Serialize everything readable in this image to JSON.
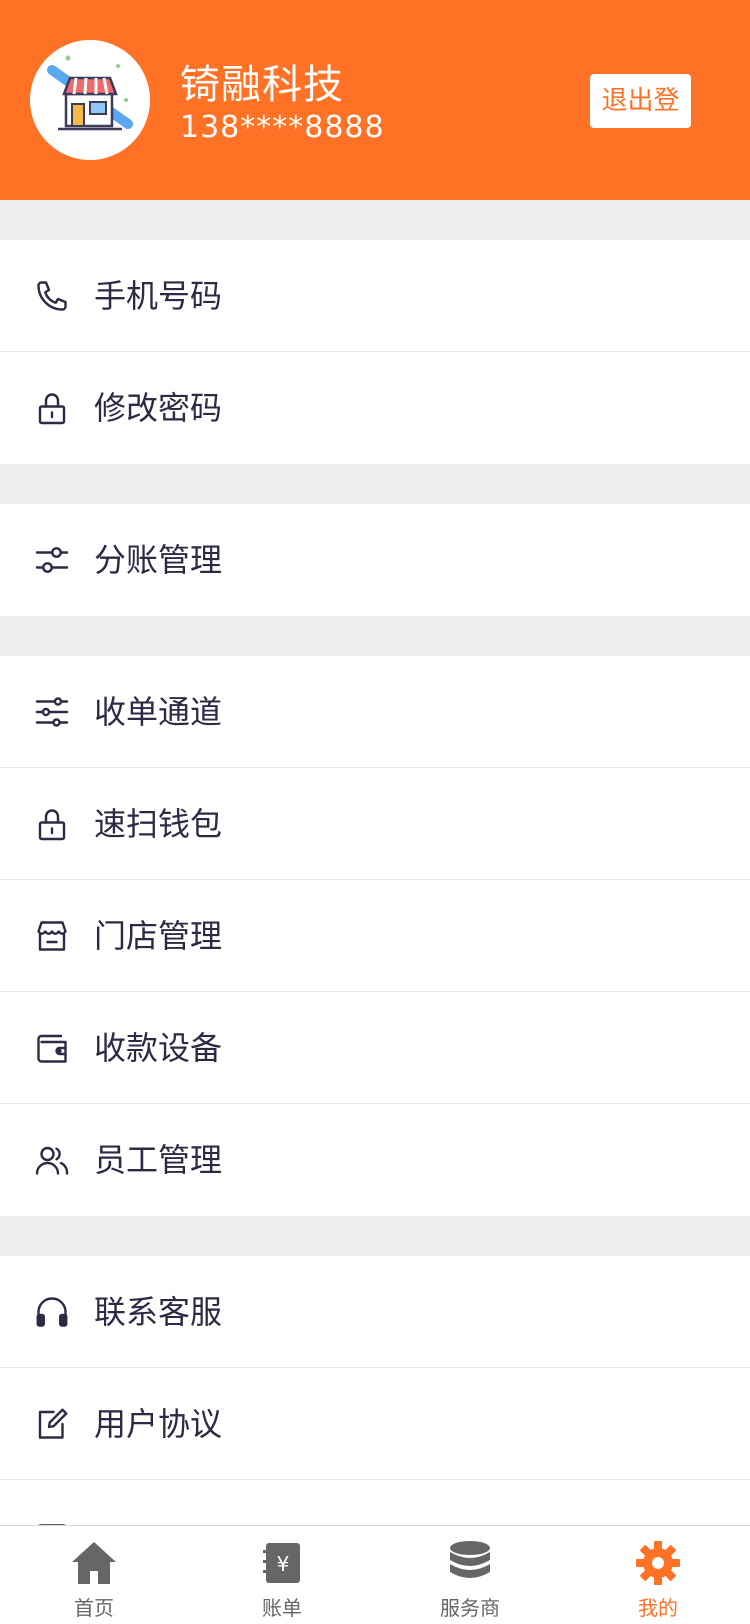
{
  "header": {
    "company_name": "锜融科技",
    "phone": "138****8888",
    "logout_label": "退出登录",
    "accent_color": "#ff7124"
  },
  "groups": [
    {
      "items": [
        {
          "label": "手机号码",
          "icon": "phone-icon"
        },
        {
          "label": "修改密码",
          "icon": "lock-icon"
        }
      ]
    },
    {
      "items": [
        {
          "label": "分账管理",
          "icon": "toggle-sliders-icon"
        }
      ]
    },
    {
      "items": [
        {
          "label": "收单通道",
          "icon": "sliders-icon"
        },
        {
          "label": "速扫钱包",
          "icon": "lock-icon"
        },
        {
          "label": "门店管理",
          "icon": "store-icon"
        },
        {
          "label": "收款设备",
          "icon": "wallet-icon"
        },
        {
          "label": "员工管理",
          "icon": "users-icon"
        }
      ]
    },
    {
      "items": [
        {
          "label": "联系客服",
          "icon": "headphones-icon"
        },
        {
          "label": "用户协议",
          "icon": "edit-icon"
        }
      ]
    }
  ],
  "tabbar": {
    "tabs": [
      {
        "label": "首页",
        "icon": "home-icon",
        "active": false
      },
      {
        "label": "账单",
        "icon": "bill-icon",
        "active": false
      },
      {
        "label": "服务商",
        "icon": "database-icon",
        "active": false
      },
      {
        "label": "我的",
        "icon": "gear-icon",
        "active": true
      }
    ],
    "active_color": "#ff7124",
    "inactive_color": "#666666"
  }
}
